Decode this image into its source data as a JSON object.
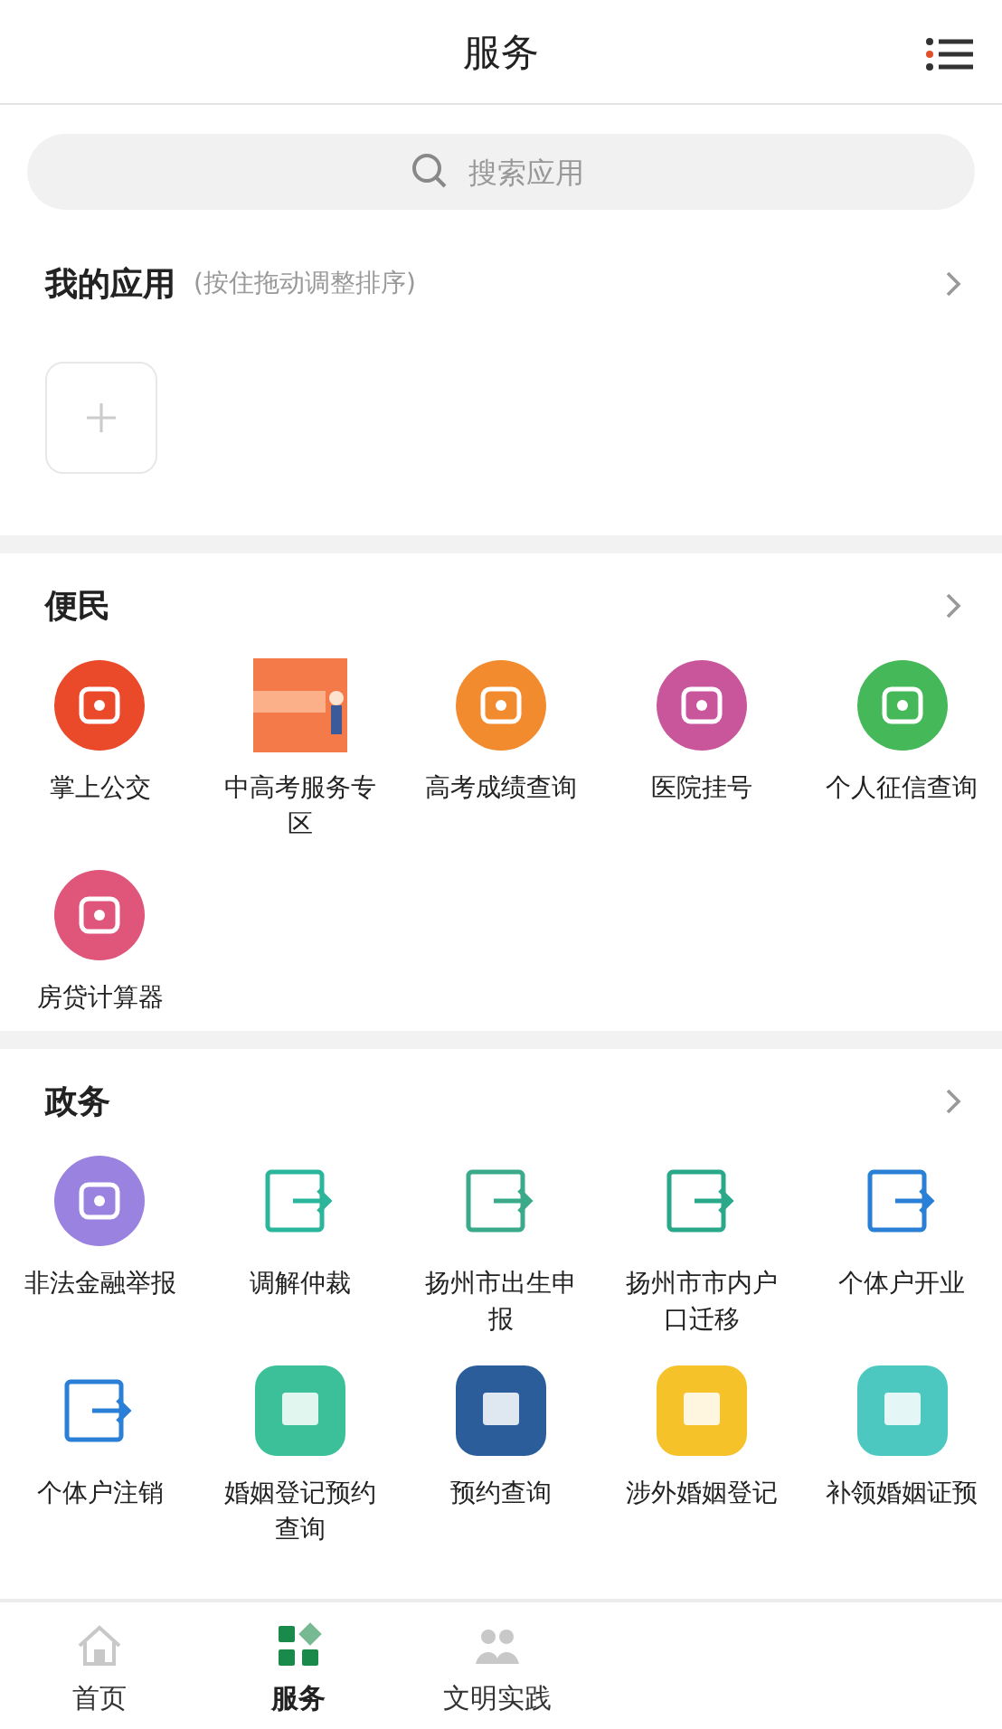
{
  "header": {
    "title": "服务"
  },
  "search": {
    "placeholder": "搜索应用"
  },
  "my_apps": {
    "title": "我的应用",
    "hint": "(按住拖动调整排序)"
  },
  "sections": [
    {
      "title": "便民",
      "apps": [
        {
          "label": "掌上公交",
          "kind": "badge",
          "color": "#ea4a2a"
        },
        {
          "label": "中高考服务专区",
          "kind": "picture",
          "color": "#f47a4a"
        },
        {
          "label": "高考成绩查询",
          "kind": "badge",
          "color": "#f28a2e"
        },
        {
          "label": "医院挂号",
          "kind": "badge",
          "color": "#c9559a"
        },
        {
          "label": "个人征信查询",
          "kind": "badge",
          "color": "#45b85a"
        },
        {
          "label": "房贷计算器",
          "kind": "badge",
          "color": "#e0557a"
        }
      ]
    },
    {
      "title": "政务",
      "apps": [
        {
          "label": "非法金融举报",
          "kind": "badge",
          "color": "#9a82e0"
        },
        {
          "label": "调解仲裁",
          "kind": "outline",
          "color": "#2bb59a"
        },
        {
          "label": "扬州市出生申报",
          "kind": "outline",
          "color": "#3aaa8a"
        },
        {
          "label": "扬州市市内户口迁移",
          "kind": "outline",
          "color": "#2aa88a"
        },
        {
          "label": "个体户开业",
          "kind": "outline",
          "color": "#2a7fd6"
        },
        {
          "label": "个体户注销",
          "kind": "outline",
          "color": "#2a7fd6"
        },
        {
          "label": "婚姻登记预约查询",
          "kind": "tile",
          "color": "#3cc09a"
        },
        {
          "label": "预约查询",
          "kind": "tile",
          "color": "#2a5d9a"
        },
        {
          "label": "涉外婚姻登记",
          "kind": "tile",
          "color": "#f5c22a"
        },
        {
          "label": "补领婚姻证预",
          "kind": "tile",
          "color": "#4cc8c0"
        }
      ]
    }
  ],
  "nav": [
    {
      "label": "首页",
      "selected": false
    },
    {
      "label": "服务",
      "selected": true
    },
    {
      "label": "文明实践",
      "selected": false
    }
  ]
}
